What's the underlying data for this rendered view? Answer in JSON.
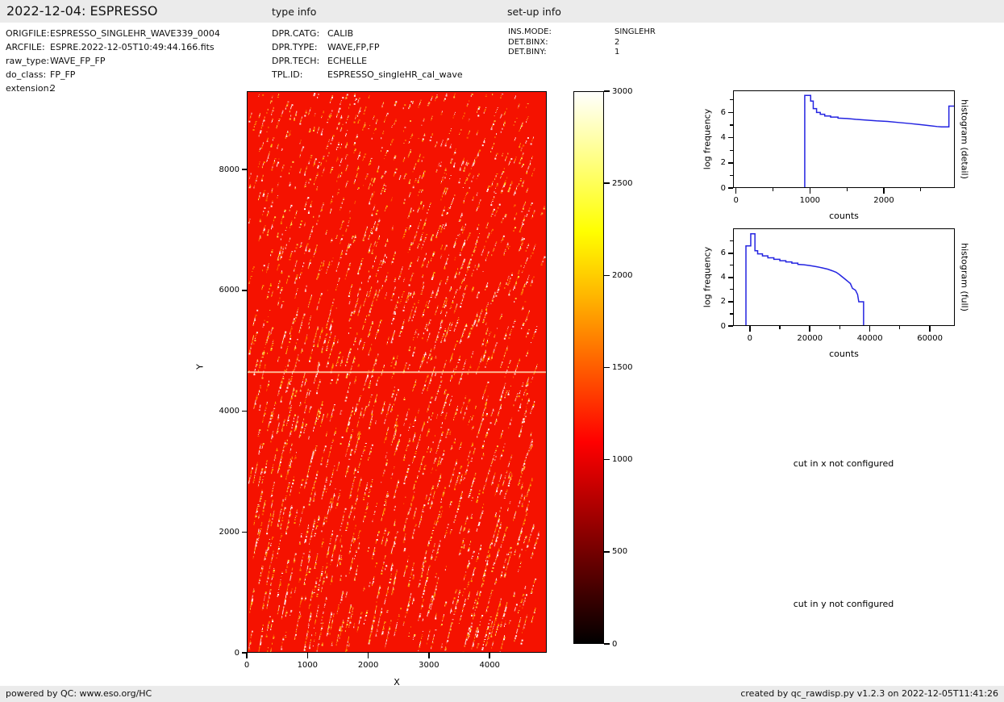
{
  "header": {
    "title": "2022-12-04: ESPRESSO",
    "type_info_label": "type info",
    "setup_info_label": "set-up info"
  },
  "file_info": {
    "rows": [
      {
        "label": "ORIGFILE:",
        "value": "ESPRESSO_SINGLEHR_WAVE339_0004"
      },
      {
        "label": "ARCFILE:",
        "value": "ESPRE.2022-12-05T10:49:44.166.fits"
      },
      {
        "label": "raw_type:",
        "value": "WAVE_FP_FP"
      },
      {
        "label": "do_class:",
        "value": "FP_FP"
      },
      {
        "label": "extension:",
        "value": "2"
      }
    ]
  },
  "type_info": {
    "rows": [
      {
        "label": "DPR.CATG:",
        "value": "CALIB"
      },
      {
        "label": "DPR.TYPE:",
        "value": "WAVE,FP,FP"
      },
      {
        "label": "DPR.TECH:",
        "value": "ECHELLE"
      },
      {
        "label": "TPL.ID:",
        "value": "ESPRESSO_singleHR_cal_wave"
      }
    ]
  },
  "setup_info": {
    "rows": [
      {
        "label": "INS.MODE:",
        "value": "SINGLEHR"
      },
      {
        "label": "DET.BINX:",
        "value": "2"
      },
      {
        "label": "DET.BINY:",
        "value": "1"
      }
    ]
  },
  "messages": {
    "cut_x": "cut in x not configured",
    "cut_y": "cut in y not configured"
  },
  "footer": {
    "left": "powered by QC: www.eso.org/HC",
    "right": "created by qc_rawdisp.py v1.2.3 on 2022-12-05T11:41:26"
  },
  "colors": {
    "bar_background": "#ebebeb",
    "histogram_line": "#2424e1",
    "frame": "#000000"
  },
  "chart_data": [
    {
      "id": "raw_frame_image",
      "type": "heatmap",
      "xlabel": "X",
      "ylabel": "Y",
      "xlim": [
        0,
        4940
      ],
      "ylim": [
        0,
        9300
      ],
      "x_ticks": [
        0,
        1000,
        2000,
        3000,
        4000
      ],
      "y_ticks": [
        0,
        2000,
        4000,
        6000,
        8000
      ],
      "colormap": "hot",
      "description": "ESPRESSO raw Fabry-Perot wave frame: dense dotted near-vertical echelle order streaks (white/yellow/orange on saturated red background ~1000 counts), pale horizontal detector gap line at y≈4650, faint vertical seam at x≈2470, sparse plain-red right margin",
      "colorbar": {
        "range": [
          0,
          3000
        ],
        "ticks": [
          0,
          500,
          1000,
          1500,
          2000,
          2500,
          3000
        ],
        "gradient_stops": [
          {
            "c": "#000000",
            "p": 0
          },
          {
            "c": "#570000",
            "p": 12.5
          },
          {
            "c": "#af0000",
            "p": 25
          },
          {
            "c": "#ff0000",
            "p": 36.5
          },
          {
            "c": "#ff5d00",
            "p": 50
          },
          {
            "c": "#ffb300",
            "p": 62.5
          },
          {
            "c": "#ffff00",
            "p": 74.6
          },
          {
            "c": "#ffff82",
            "p": 87.5
          },
          {
            "c": "#ffffff",
            "p": 100
          }
        ]
      },
      "render": {
        "base_color": "#f51200",
        "dot_colors": [
          "#ffffff",
          "#ffe44f",
          "#ffb008",
          "#ff7100"
        ],
        "gap_y": 4650,
        "seam_x": 2470,
        "seed": 42
      }
    },
    {
      "id": "histogram_detail",
      "type": "line",
      "line_color": "#2424e1",
      "xlabel": "counts",
      "ylabel": "log frequency",
      "right_label": "histogram (detail)",
      "xlim": [
        -40,
        2960
      ],
      "ylim": [
        0,
        7.75
      ],
      "x_ticks": [
        0,
        1000,
        2000
      ],
      "x_minor_ticks": [
        500,
        1500,
        2500
      ],
      "y_ticks": [
        0,
        2,
        4,
        6
      ],
      "y_minor_ticks": [
        1,
        3,
        5,
        7
      ],
      "points": [
        [
          -40,
          0
        ],
        [
          930,
          0
        ],
        [
          930,
          7.35
        ],
        [
          1010,
          7.35
        ],
        [
          1010,
          6.9
        ],
        [
          1045,
          6.9
        ],
        [
          1045,
          6.3
        ],
        [
          1090,
          6.3
        ],
        [
          1090,
          6.0
        ],
        [
          1140,
          6.0
        ],
        [
          1140,
          5.85
        ],
        [
          1200,
          5.85
        ],
        [
          1200,
          5.72
        ],
        [
          1280,
          5.72
        ],
        [
          1280,
          5.63
        ],
        [
          1380,
          5.63
        ],
        [
          1380,
          5.55
        ],
        [
          1500,
          5.52
        ],
        [
          1620,
          5.45
        ],
        [
          1750,
          5.4
        ],
        [
          1900,
          5.33
        ],
        [
          2050,
          5.28
        ],
        [
          2200,
          5.2
        ],
        [
          2350,
          5.12
        ],
        [
          2500,
          5.03
        ],
        [
          2620,
          4.95
        ],
        [
          2720,
          4.88
        ],
        [
          2780,
          4.85
        ],
        [
          2880,
          4.85
        ],
        [
          2880,
          6.5
        ],
        [
          2960,
          6.5
        ]
      ]
    },
    {
      "id": "histogram_full",
      "type": "line",
      "line_color": "#2424e1",
      "xlabel": "counts",
      "ylabel": "log frequency",
      "right_label": "histogram (full)",
      "xlim": [
        -5600,
        68300
      ],
      "ylim": [
        0,
        8.05
      ],
      "x_ticks": [
        0,
        20000,
        40000,
        60000
      ],
      "x_minor_ticks": [
        10000,
        30000,
        50000
      ],
      "y_ticks": [
        0,
        2,
        4,
        6
      ],
      "y_minor_ticks": [
        1,
        3,
        5,
        7
      ],
      "points": [
        [
          -5600,
          0
        ],
        [
          -1300,
          0
        ],
        [
          -1300,
          6.6
        ],
        [
          300,
          6.6
        ],
        [
          300,
          7.6
        ],
        [
          1700,
          7.6
        ],
        [
          1700,
          6.2
        ],
        [
          2600,
          6.2
        ],
        [
          2600,
          5.95
        ],
        [
          4200,
          5.95
        ],
        [
          4200,
          5.78
        ],
        [
          6000,
          5.78
        ],
        [
          6000,
          5.62
        ],
        [
          8000,
          5.62
        ],
        [
          8000,
          5.5
        ],
        [
          10000,
          5.5
        ],
        [
          10000,
          5.38
        ],
        [
          12000,
          5.38
        ],
        [
          12000,
          5.28
        ],
        [
          14000,
          5.28
        ],
        [
          14000,
          5.18
        ],
        [
          16000,
          5.18
        ],
        [
          16000,
          5.08
        ],
        [
          18000,
          5.05
        ],
        [
          20000,
          4.98
        ],
        [
          22000,
          4.9
        ],
        [
          24000,
          4.8
        ],
        [
          26000,
          4.68
        ],
        [
          27500,
          4.55
        ],
        [
          28800,
          4.42
        ],
        [
          29800,
          4.25
        ],
        [
          30800,
          4.05
        ],
        [
          31800,
          3.85
        ],
        [
          32800,
          3.65
        ],
        [
          33500,
          3.5
        ],
        [
          34200,
          3.1
        ],
        [
          35200,
          2.95
        ],
        [
          35900,
          2.6
        ],
        [
          36300,
          2.0
        ],
        [
          37900,
          2.0
        ],
        [
          37900,
          0
        ],
        [
          68300,
          0
        ]
      ]
    }
  ]
}
